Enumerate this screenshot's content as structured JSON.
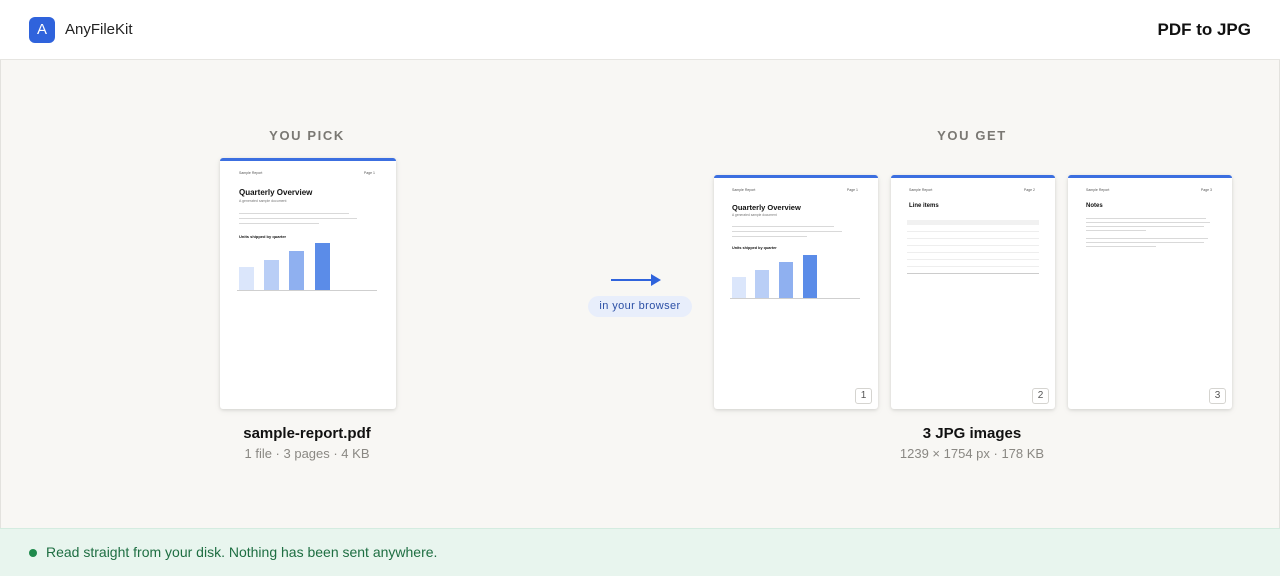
{
  "header": {
    "logo_letter": "A",
    "brand": "AnyFileKit",
    "tool_title": "PDF to JPG"
  },
  "input": {
    "section_label": "YOU PICK",
    "filename": "sample-report.pdf",
    "meta": "1 file · 3 pages · 4 KB",
    "page": {
      "head_left": "Sample Report",
      "head_right": "Page 1",
      "title": "Quarterly Overview",
      "subtitle": "A generated sample document",
      "chart_title": "Units shipped by quarter"
    }
  },
  "transfer": {
    "pill": "in your browser"
  },
  "output": {
    "section_label": "YOU GET",
    "title": "3 JPG images",
    "meta": "1239 × 1754 px · 178 KB",
    "pages": [
      {
        "number": "1",
        "head_left": "Sample Report",
        "head_right": "Page 1",
        "title": "Quarterly Overview",
        "subtitle": "A generated sample document",
        "chart_title": "Units shipped by quarter"
      },
      {
        "number": "2",
        "head_left": "Sample Report",
        "head_right": "Page 2",
        "title": "Line items"
      },
      {
        "number": "3",
        "head_left": "Sample Report",
        "head_right": "Page 3",
        "title": "Notes"
      }
    ]
  },
  "footer": {
    "status_text": "Read straight from your disk. Nothing has been sent anywhere.",
    "status_color": "#1f8a4c"
  },
  "colors": {
    "accent": "#2f63dc",
    "bar_colors": [
      "#dbe6fb",
      "#b9cef6",
      "#8fb0f0",
      "#5b8ce8"
    ]
  }
}
